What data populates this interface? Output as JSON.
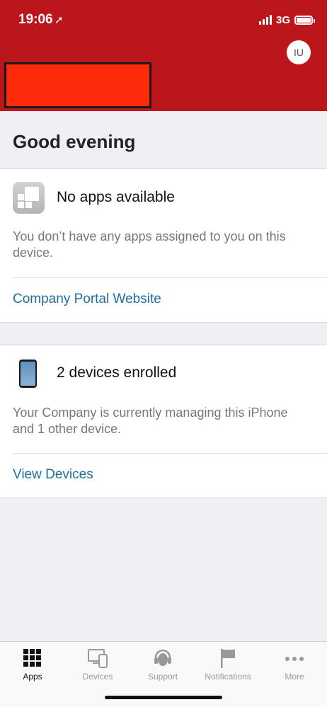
{
  "status_bar": {
    "time": "19:06",
    "location_arrow": "➚",
    "network": "3G"
  },
  "header": {
    "avatar_initials": "IU",
    "background_color": "#bb161b"
  },
  "greeting": "Good evening",
  "apps_card": {
    "icon": "apps-grid-icon",
    "title": "No apps available",
    "description": "You don’t have any apps assigned to you on this device.",
    "link": "Company Portal Website"
  },
  "devices_card": {
    "icon": "phone-icon",
    "title": "2 devices enrolled",
    "description": "Your Company is currently managing this iPhone and 1 other device.",
    "link": "View Devices"
  },
  "tabbar": {
    "tabs": [
      {
        "label": "Apps",
        "icon": "apps-grid-icon",
        "active": true
      },
      {
        "label": "Devices",
        "icon": "devices-icon",
        "active": false
      },
      {
        "label": "Support",
        "icon": "headset-icon",
        "active": false
      },
      {
        "label": "Notifications",
        "icon": "flag-icon",
        "active": false
      },
      {
        "label": "More",
        "icon": "more-dots-icon",
        "active": false
      }
    ]
  },
  "colors": {
    "accent_link": "#1f6e9d",
    "redaction": "#ff2a0a"
  }
}
